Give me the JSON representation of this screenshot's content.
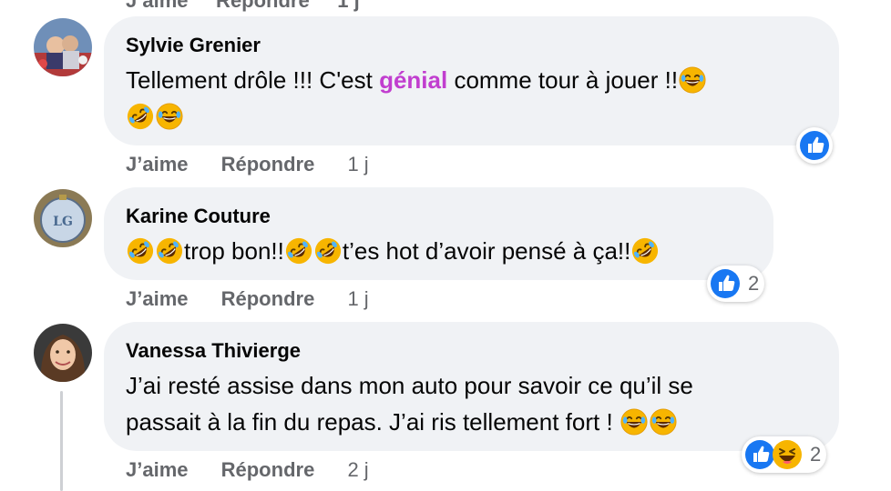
{
  "comments": [
    {
      "author": "Sylvie Grenier",
      "text_parts": {
        "a": "Tellement drôle !!! C'est ",
        "b": "génial",
        "c": " comme tour à jouer !!"
      },
      "like_label": "J’aime",
      "reply_label": "Répondre",
      "time": "1 j",
      "reactions": {
        "types": [
          "like-icon"
        ],
        "count": ""
      }
    },
    {
      "author": "Karine Couture",
      "text_parts": {
        "a": "trop bon!!",
        "b": "t’es hot d’avoir pensé à ça!!"
      },
      "like_label": "J’aime",
      "reply_label": "Répondre",
      "time": "1 j",
      "reactions": {
        "types": [
          "like-icon"
        ],
        "count": "2"
      }
    },
    {
      "author": "Vanessa Thivierge",
      "text_parts": {
        "line1": "J’ai resté assise dans mon auto pour savoir ce qu’il se",
        "line2": "passait à la fin du repas. J’ai ris tellement fort ! "
      },
      "like_label": "J’aime",
      "reply_label": "Répondre",
      "time": "2 j",
      "reactions": {
        "types": [
          "like-icon",
          "haha-icon"
        ],
        "count": "2"
      }
    }
  ],
  "colors": {
    "bubble": "#f0f2f5",
    "secondary_text": "#65676b",
    "highlight": "#c13ecf",
    "like_blue": "#1877f2"
  }
}
